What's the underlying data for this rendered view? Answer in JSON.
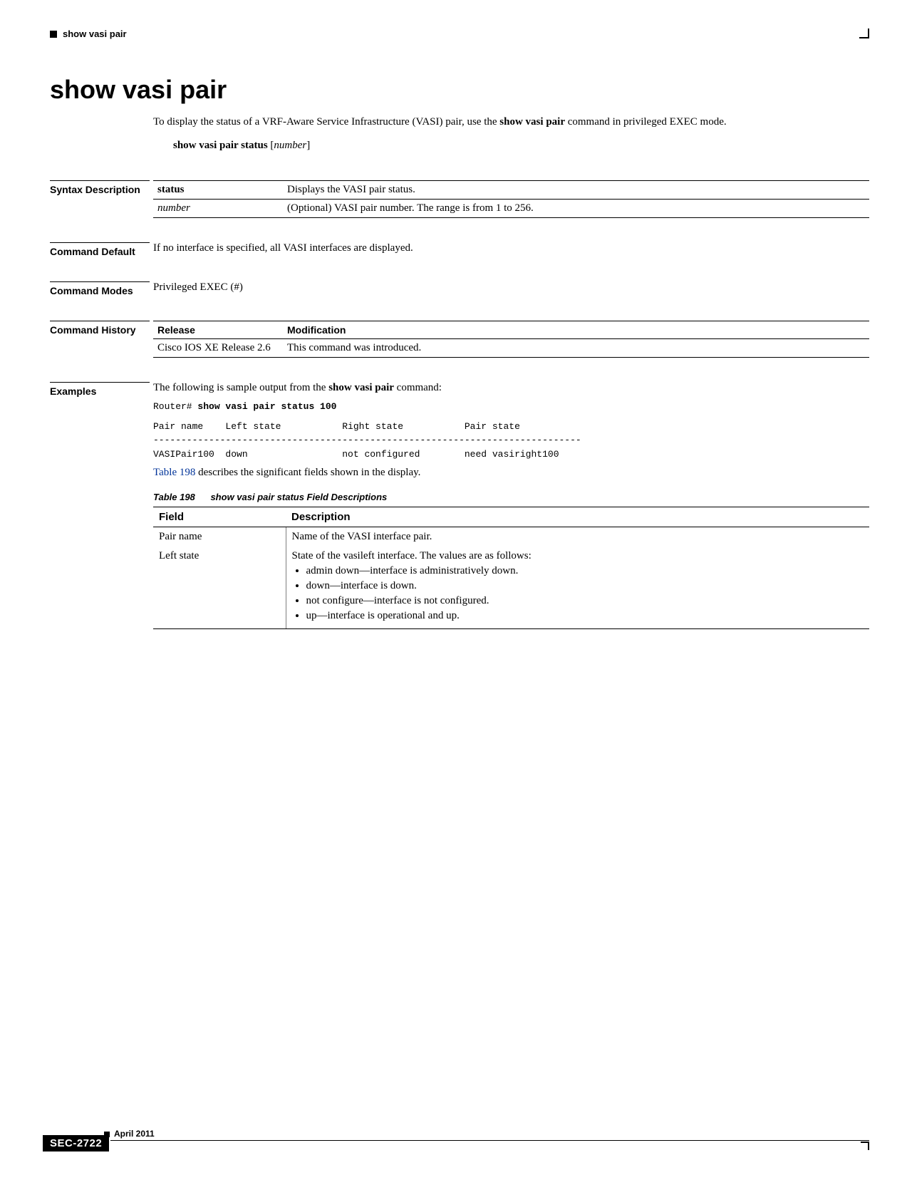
{
  "header": {
    "running": "show vasi pair"
  },
  "title": "show vasi pair",
  "intro": {
    "pre": "To display the status of a VRF-Aware Service Infrastructure (VASI) pair, use the ",
    "cmd": "show vasi pair",
    "post": " command in privileged EXEC mode."
  },
  "syntax": {
    "cmd": "show vasi pair status",
    "arg": "number"
  },
  "sections": {
    "syntax_desc": {
      "label": "Syntax Description",
      "rows": [
        {
          "term": "status",
          "term_style": "bold",
          "desc": "Displays the VASI pair status."
        },
        {
          "term": "number",
          "term_style": "italic",
          "desc": "(Optional) VASI pair number. The range is from 1 to 256."
        }
      ]
    },
    "cmd_default": {
      "label": "Command Default",
      "text": "If no interface is specified, all VASI interfaces are displayed."
    },
    "cmd_modes": {
      "label": "Command Modes",
      "text": "Privileged EXEC (#)"
    },
    "cmd_history": {
      "label": "Command History",
      "head": {
        "release": "Release",
        "mod": "Modification"
      },
      "rows": [
        {
          "release": "Cisco IOS XE Release 2.6",
          "mod": "This command was introduced."
        }
      ]
    },
    "examples": {
      "label": "Examples",
      "lead_pre": "The following is sample output from the ",
      "lead_cmd": "show vasi pair",
      "lead_post": " command:",
      "cli_prompt": "Router# ",
      "cli_cmd": "show vasi pair status 100",
      "output": "Pair name    Left state           Right state           Pair state\n-----------------------------------------------------------------------------\nVASIPair100  down                 not configured        need vasiright100",
      "table_ref": "Table 198",
      "table_ref_post": " describes the significant fields shown in the display.",
      "table_caption_num": "Table 198",
      "table_caption_txt": "show vasi pair status Field Descriptions",
      "field_table": {
        "head": {
          "field": "Field",
          "desc": "Description"
        },
        "rows": [
          {
            "field": "Pair name",
            "desc": "Name of the VASI interface pair."
          },
          {
            "field": "Left state",
            "desc": "State of the vasileft interface. The values are as follows:",
            "bullets": [
              "admin down—interface is administratively down.",
              "down—interface is down.",
              "not configure—interface is not configured.",
              "up—interface is operational and up."
            ]
          }
        ]
      }
    }
  },
  "footer": {
    "date": "April 2011",
    "badge": "SEC-2722"
  }
}
